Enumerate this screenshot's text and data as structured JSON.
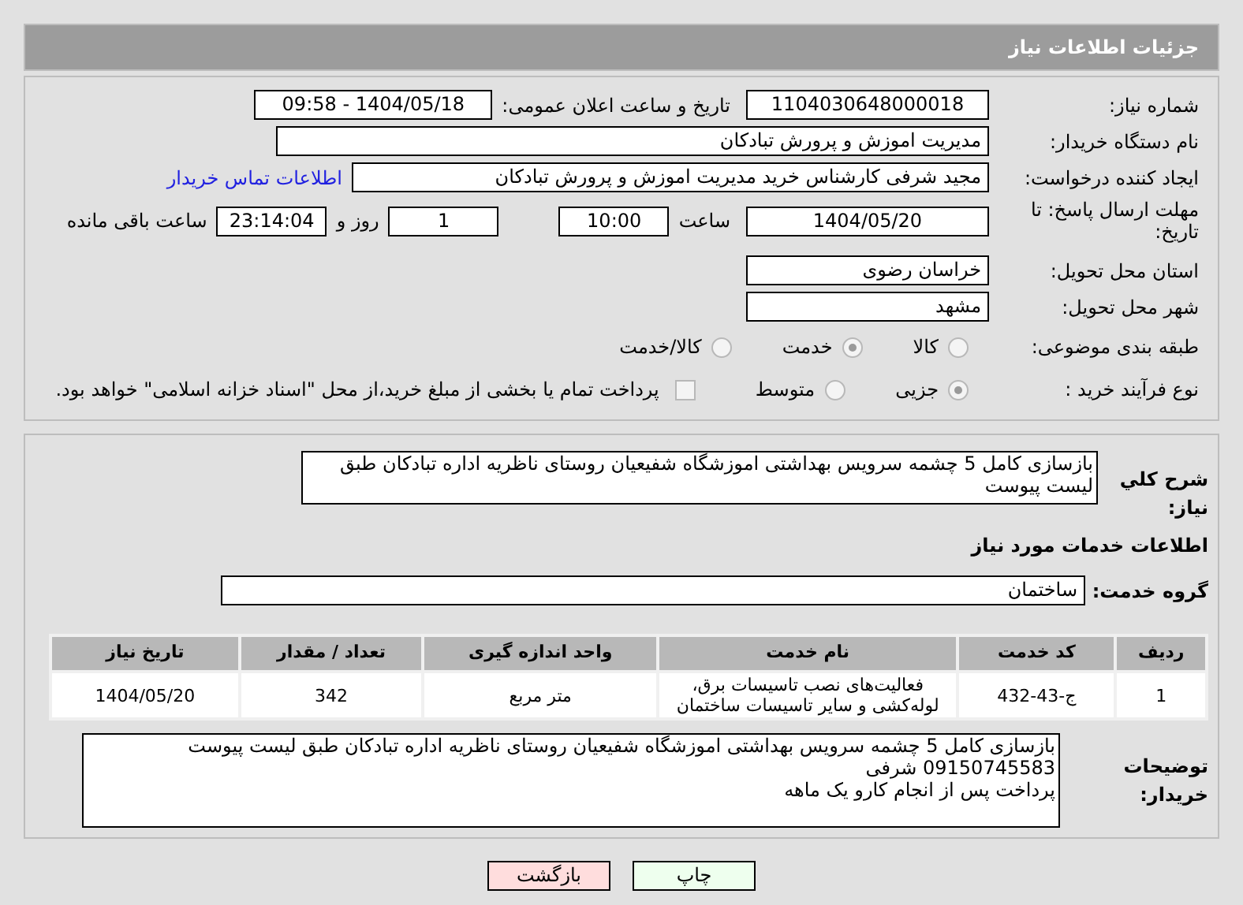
{
  "header": {
    "title": "جزئیات اطلاعات نیاز"
  },
  "details": {
    "need_number": {
      "label": "شماره نیاز:",
      "value": "1104030648000018"
    },
    "announce": {
      "label": "تاریخ و ساعت اعلان عمومی:",
      "value": "1404/05/18 - 09:58"
    },
    "buyer": {
      "label": "نام دستگاه خریدار:",
      "value": "مدیریت اموزش و پرورش تبادکان"
    },
    "requester": {
      "label": "ایجاد کننده درخواست:",
      "value": "مجید شرفی کارشناس خرید مدیریت اموزش و پرورش تبادکان",
      "link": "اطلاعات تماس خریدار"
    },
    "deadline": {
      "label": "مهلت ارسال پاسخ: تا تاریخ:",
      "date": "1404/05/20",
      "time_label": "ساعت",
      "time": "10:00",
      "days": "1",
      "days_label": "روز و",
      "remaining": "23:14:04",
      "remaining_label": "ساعت باقی مانده"
    },
    "province": {
      "label": "استان محل تحویل:",
      "value": "خراسان رضوی"
    },
    "city": {
      "label": "شهر محل تحویل:",
      "value": "مشهد"
    },
    "category": {
      "label": "طبقه بندی موضوعی:",
      "options": [
        {
          "label": "کالا",
          "selected": false
        },
        {
          "label": "خدمت",
          "selected": true
        },
        {
          "label": "کالا/خدمت",
          "selected": false
        }
      ]
    },
    "purchase_type": {
      "label": "نوع فرآیند خرید :",
      "options": [
        {
          "label": "جزیی",
          "selected": true
        },
        {
          "label": "متوسط",
          "selected": false
        }
      ],
      "treasury": {
        "checked": false,
        "label": "پرداخت تمام یا بخشی از مبلغ خرید،از محل \"اسناد خزانه اسلامی\" خواهد بود."
      }
    }
  },
  "summary": {
    "label": "شرح کلي نياز:",
    "value": "بازسازی کامل 5 چشمه سرویس بهداشتی اموزشگاه شفیعیان روستای ناظریه اداره تبادکان طبق لیست پیوست"
  },
  "services": {
    "heading": "اطلاعات خدمات مورد نیاز",
    "group_label": "گروه خدمت:",
    "group": "ساختمان",
    "columns": [
      "ردیف",
      "کد خدمت",
      "نام خدمت",
      "واحد اندازه گیری",
      "تعداد / مقدار",
      "تاریخ نیاز"
    ],
    "rows": [
      [
        "1",
        "ج-43-432",
        "فعالیت‌های نصب تاسیسات برق، لوله‌کشی و سایر تاسیسات ساختمان",
        "متر مربع",
        "342",
        "1404/05/20"
      ]
    ]
  },
  "notes": {
    "label": "توضیحات خریدار:",
    "lines": [
      "بازسازی کامل 5 چشمه سرویس بهداشتی اموزشگاه شفیعیان روستای ناظریه اداره تبادکان طبق لیست پیوست",
      "09150745583 شرفی",
      "پرداخت پس از انجام کارو یک ماهه"
    ]
  },
  "buttons": [
    {
      "label": "چاپ",
      "kind": "print"
    },
    {
      "label": "بازگشت",
      "kind": "back"
    }
  ]
}
